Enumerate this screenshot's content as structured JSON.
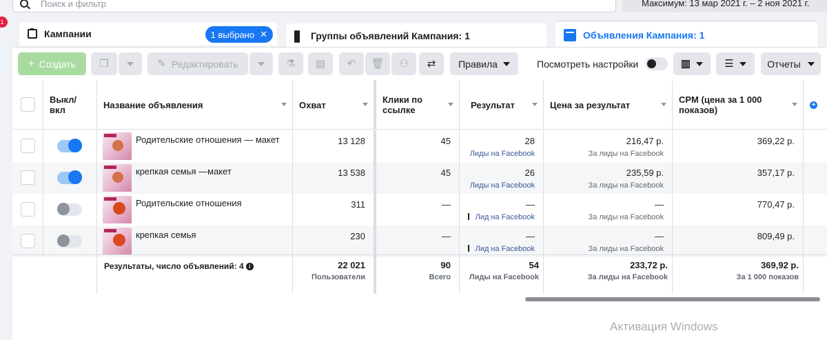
{
  "search": {
    "placeholder": "Поиск и фильтр"
  },
  "date_range": "Максимум: 13 мар 2021 г. – 2 ноя 2021 г.",
  "notification_count": "1",
  "tabs": [
    {
      "label": "Кампании",
      "pill": "1 выбрано"
    },
    {
      "label": "Группы объявлений Кампания: 1"
    },
    {
      "label": "Объявления Кампания: 1"
    }
  ],
  "toolbar": {
    "create": "Создать",
    "edit": "Редактировать",
    "rules": "Правила",
    "view_settings": "Посмотреть настройки",
    "reports": "Отчеты"
  },
  "columns": {
    "onoff": "Выкл/ вкл",
    "name": "Название объявления",
    "reach": "Охват",
    "clicks": "Клики по ссылке",
    "result": "Результат",
    "cost": "Цена за результат",
    "cpm": "CPM (цена за 1 000 показов)"
  },
  "rows": [
    {
      "name": "Родительские отношения — макет",
      "on": true,
      "reach": "13 128",
      "clicks": "45",
      "result": "28",
      "result_sub": "Лиды на Facebook",
      "cost": "216,47 р.",
      "cost_sub": "За лиды на Facebook",
      "cpm": "369,22 р."
    },
    {
      "name": "крепкая семья —макет",
      "on": true,
      "reach": "13 538",
      "clicks": "45",
      "result": "26",
      "result_sub": "Лиды на Facebook",
      "cost": "235,59 р.",
      "cost_sub": "За лиды на Facebook",
      "cpm": "357,17 р."
    },
    {
      "name": "Родительские отношения",
      "on": false,
      "reach": "311",
      "clicks": "—",
      "result": "—",
      "result_sub": "Лид на Facebook",
      "cost": "—",
      "cost_sub": "За лиды на Facebook",
      "cpm": "770,47 р."
    },
    {
      "name": "крепкая семья",
      "on": false,
      "reach": "230",
      "clicks": "—",
      "result": "—",
      "result_sub": "Лид на Facebook",
      "cost": "—",
      "cost_sub": "За лиды на Facebook",
      "cpm": "809,49 р."
    }
  ],
  "totals": {
    "label": "Результаты, число объявлений: 4",
    "reach": "22 021",
    "reach_sub": "Пользователи",
    "clicks": "90",
    "clicks_sub": "Всего",
    "result": "54",
    "result_sub": "Лиды на Facebook",
    "cost": "233,72 р.",
    "cost_sub": "За лиды на Facebook",
    "cpm": "369,92 р.",
    "cpm_sub": "За 1 000 показов"
  },
  "watermark": "Активация Windows",
  "colors": {
    "accent": "#1877f2",
    "create_button": "#a8dba0"
  }
}
